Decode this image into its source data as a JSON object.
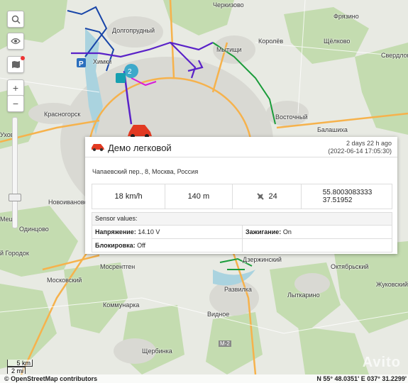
{
  "map": {
    "places": [
      "Черкизово",
      "Фрязино",
      "Долгопрудный",
      "Химки",
      "Королёв",
      "Щёлково",
      "Мытищи",
      "Свердлов",
      "Восточный",
      "Балашиха",
      "Красногорск",
      "Новоивановс",
      "Одинцово",
      "й Городок",
      "Московский",
      "Мосрентген",
      "Коммунарка",
      "Развилка",
      "Видное",
      "Лыткарино",
      "Октябрьский",
      "Жуковский",
      "Щербинка",
      "Дзержинский",
      "Ухов",
      "Мещ"
    ],
    "road_labels": [
      "М-2"
    ],
    "cluster_count": "2",
    "parking_label": "P",
    "watermark": "Avito"
  },
  "controls": {
    "search_icon": "search-icon",
    "eye_icon": "eye-icon",
    "map_icon": "map-icon",
    "zoom_in": "+",
    "zoom_out": "−"
  },
  "popup": {
    "name": "Демо легковой",
    "ago": "2 days 22 h ago",
    "datetime": "(2022-06-14 17:05:30)",
    "address": "Чапаевский пер., 8, Москва, Россия",
    "speed": "18 km/h",
    "distance": "140 m",
    "satellites": "24",
    "lat": "55.8003083333",
    "lon": "37.51952",
    "sensors_title": "Sensor values:",
    "voltage_label": "Напряжение:",
    "voltage_value": "14.10 V",
    "ignition_label": "Зажигание:",
    "ignition_value": "On",
    "block_label": "Блокировка:",
    "block_value": "Off"
  },
  "scale": {
    "km": "5 km",
    "mi": "2 mi"
  },
  "attribution": "© OpenStreetMap contributors",
  "coordinates": "N 55° 48.0351' E 037° 31.2299'",
  "colors": {
    "track_purple": "#5a22c8",
    "track_blue": "#1845a8",
    "track_green": "#1a9c3a",
    "road_orange": "#f6b24c",
    "forest": "#c4dcb0",
    "urban": "#dcdcd6"
  }
}
